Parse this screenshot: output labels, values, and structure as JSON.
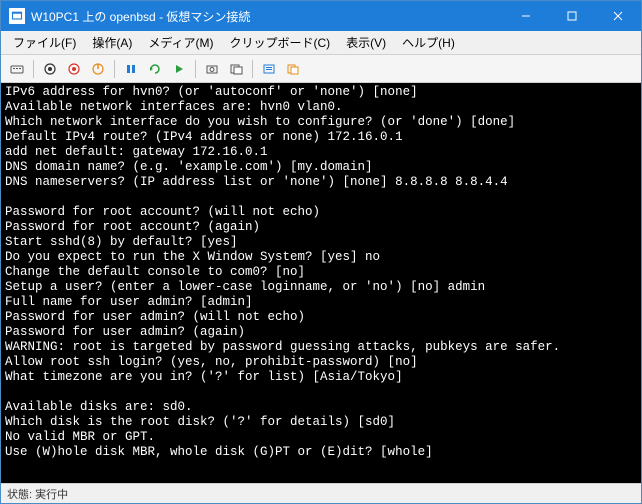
{
  "titlebar": {
    "text": "W10PC1 上の openbsd - 仮想マシン接続"
  },
  "menu": {
    "file": "ファイル(F)",
    "action": "操作(A)",
    "media": "メディア(M)",
    "clipboard": "クリップボード(C)",
    "view": "表示(V)",
    "help": "ヘルプ(H)"
  },
  "terminal": {
    "lines": [
      "IPv6 address for hvn0? (or 'autoconf' or 'none') [none]",
      "Available network interfaces are: hvn0 vlan0.",
      "Which network interface do you wish to configure? (or 'done') [done]",
      "Default IPv4 route? (IPv4 address or none) 172.16.0.1",
      "add net default: gateway 172.16.0.1",
      "DNS domain name? (e.g. 'example.com') [my.domain]",
      "DNS nameservers? (IP address list or 'none') [none] 8.8.8.8 8.8.4.4",
      "",
      "Password for root account? (will not echo)",
      "Password for root account? (again)",
      "Start sshd(8) by default? [yes]",
      "Do you expect to run the X Window System? [yes] no",
      "Change the default console to com0? [no]",
      "Setup a user? (enter a lower-case loginname, or 'no') [no] admin",
      "Full name for user admin? [admin]",
      "Password for user admin? (will not echo)",
      "Password for user admin? (again)",
      "WARNING: root is targeted by password guessing attacks, pubkeys are safer.",
      "Allow root ssh login? (yes, no, prohibit-password) [no]",
      "What timezone are you in? ('?' for list) [Asia/Tokyo]",
      "",
      "Available disks are: sd0.",
      "Which disk is the root disk? ('?' for details) [sd0]",
      "No valid MBR or GPT.",
      "Use (W)hole disk MBR, whole disk (G)PT or (E)dit? [whole]"
    ]
  },
  "statusbar": {
    "label": "状態:",
    "value": "実行中"
  }
}
